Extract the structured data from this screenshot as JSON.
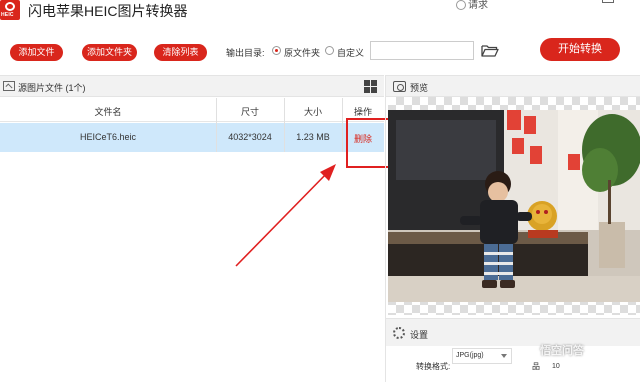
{
  "app": {
    "logo_text": "HEIC",
    "title": "闪电苹果HEIC图片转换器",
    "user_label": "请求"
  },
  "toolbar": {
    "add_file": "添加文件",
    "add_folder": "添加文件夹",
    "clear_list": "清除列表",
    "output_label": "输出目录:",
    "output_options": [
      "原文件夹",
      "自定义"
    ],
    "output_selected": "原文件夹",
    "path_value": "",
    "start": "开始转换"
  },
  "file_list": {
    "title": "源图片文件 (1个)",
    "columns": [
      "文件名",
      "尺寸",
      "大小",
      "操作"
    ],
    "rows": [
      {
        "name": "HEICeT6.heic",
        "dimensions": "4032*3024",
        "size": "1.23 MB",
        "action": "删除"
      }
    ]
  },
  "preview": {
    "title": "预览"
  },
  "settings": {
    "title": "设置",
    "format_label": "转换格式:",
    "format_value": "JPG(jpg)",
    "quality_label": "品",
    "quality_value": "10"
  },
  "watermark": "悟空问答",
  "colors": {
    "accent": "#d9261c",
    "selected_row": "#cfe8fb",
    "annotation": "#e02020"
  }
}
